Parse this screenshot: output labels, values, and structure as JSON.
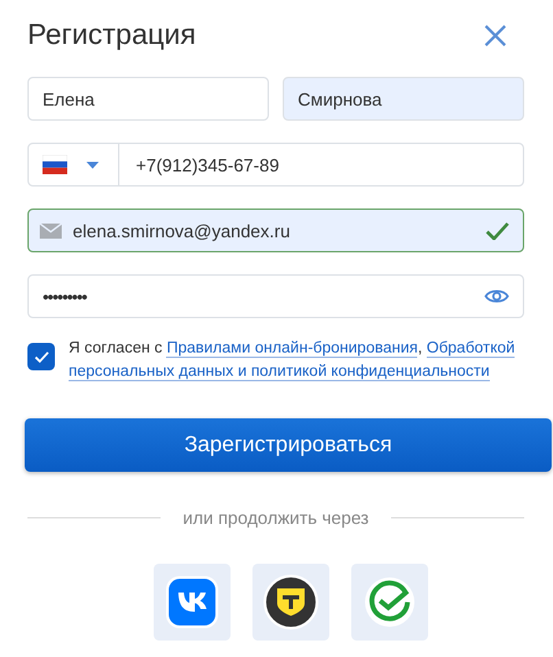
{
  "title": "Регистрация",
  "first_name": {
    "value": "Елена",
    "autofilled": false
  },
  "last_name": {
    "value": "Смирнова",
    "autofilled": true
  },
  "phone": {
    "value": "+7(912)345-67-89"
  },
  "email": {
    "value": "elena.smirnova@yandex.ru",
    "autofilled": true,
    "valid": true
  },
  "password": {
    "value": "•••••••••"
  },
  "consent": {
    "checked": true,
    "parts": [
      {
        "kind": "text",
        "text": "Я согласен с "
      },
      {
        "kind": "link",
        "text": "Правилами онлайн-бронирования"
      },
      {
        "kind": "text",
        "text": ", "
      },
      {
        "kind": "link",
        "text": "Обработкой"
      },
      {
        "kind": "link",
        "text": "персональных данных и политикой конфиденциальности"
      }
    ]
  },
  "submit": "Зарегистрироваться",
  "divider": "или продолжить через",
  "social": [
    {
      "kind": "vk"
    },
    {
      "kind": "tbank"
    },
    {
      "kind": "sber"
    }
  ]
}
